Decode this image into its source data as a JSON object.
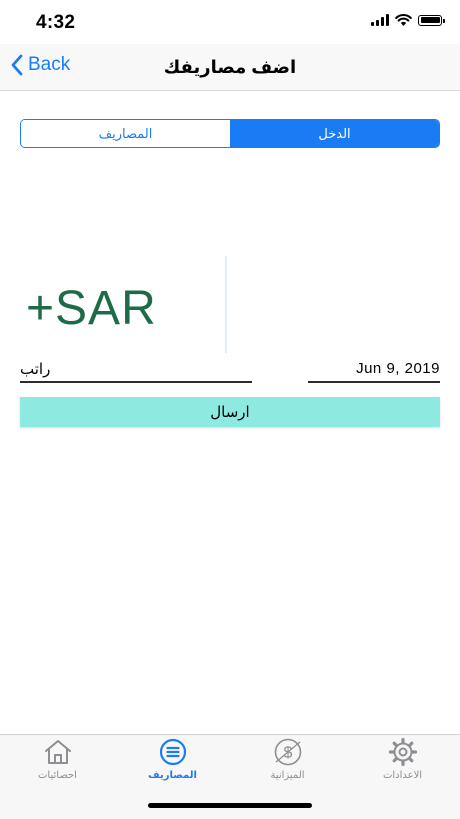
{
  "status": {
    "time": "4:32"
  },
  "nav": {
    "back_label": "Back",
    "title": "اضف مصاريفك"
  },
  "segment": {
    "expenses_label": "المصاريف",
    "income_label": "الدخل",
    "selected": "income"
  },
  "amount": {
    "display": "+SAR"
  },
  "form": {
    "note_value": "راتب",
    "date_value": "Jun 9, 2019",
    "send_label": "ارسال"
  },
  "tabs": [
    {
      "label": "احصائيات",
      "icon": "home-icon"
    },
    {
      "label": "المصاريف",
      "icon": "list-icon",
      "active": true
    },
    {
      "label": "الميزانية",
      "icon": "dollar-icon"
    },
    {
      "label": "الاعدادات",
      "icon": "gear-icon"
    }
  ],
  "colors": {
    "accent": "#1a7cf5",
    "amount": "#1f6b48",
    "send_bg": "#8eeae0"
  }
}
